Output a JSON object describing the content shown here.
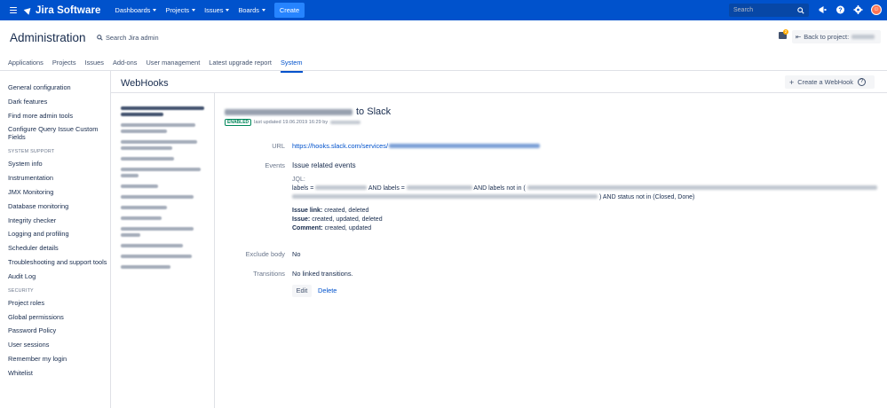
{
  "topbar": {
    "product": "Jira Software",
    "nav": [
      {
        "label": "Dashboards"
      },
      {
        "label": "Projects"
      },
      {
        "label": "Issues"
      },
      {
        "label": "Boards"
      }
    ],
    "create_label": "Create",
    "search_placeholder": "Search",
    "icons": [
      "megaphone-icon",
      "help-icon",
      "settings-icon",
      "user-avatar"
    ],
    "brand_color": "#0052cc"
  },
  "header": {
    "title": "Administration",
    "search_label": "Search Jira admin",
    "notification_count": "2",
    "back_label": "Back to project:"
  },
  "tabs": [
    {
      "label": "Applications"
    },
    {
      "label": "Projects"
    },
    {
      "label": "Issues"
    },
    {
      "label": "Add-ons"
    },
    {
      "label": "User management"
    },
    {
      "label": "Latest upgrade report"
    },
    {
      "label": "System",
      "active": true
    }
  ],
  "sidebar": {
    "group1": [
      "General configuration",
      "Dark features",
      "Find more admin tools",
      "Configure Query Issue Custom Fields"
    ],
    "system_support_heading": "SYSTEM SUPPORT",
    "group2": [
      "System info",
      "Instrumentation",
      "JMX Monitoring",
      "Database monitoring",
      "Integrity checker",
      "Logging and profiling",
      "Scheduler details",
      "Troubleshooting and support tools",
      "Audit Log"
    ],
    "security_heading": "SECURITY",
    "group3": [
      "Project roles",
      "Global permissions",
      "Password Policy",
      "User sessions",
      "Remember my login",
      "Whitelist"
    ]
  },
  "main": {
    "title": "WebHooks",
    "create_button": "Create a WebHook"
  },
  "detail": {
    "title_suffix": "to Slack",
    "status": "ENABLED",
    "updated": "last updated 19.06.2019 16:29 by",
    "url_label": "URL",
    "url_value": "https://hooks.slack.com/services/",
    "events_label": "Events",
    "events_value": "Issue related events",
    "jql_label": "JQL:",
    "jql_prefix": "labels =",
    "jql_and_labels": "AND labels =",
    "jql_and_not_in": "AND labels not in (",
    "jql_status": ") AND status not in (Closed, Done)",
    "issue_link": {
      "key": "Issue link:",
      "value": "created, deleted"
    },
    "issue": {
      "key": "Issue:",
      "value": "created, updated, deleted"
    },
    "comment": {
      "key": "Comment:",
      "value": "created, updated"
    },
    "exclude_label": "Exclude body",
    "exclude_value": "No",
    "transitions_label": "Transitions",
    "transitions_value": "No linked transitions.",
    "edit_label": "Edit",
    "delete_label": "Delete"
  }
}
